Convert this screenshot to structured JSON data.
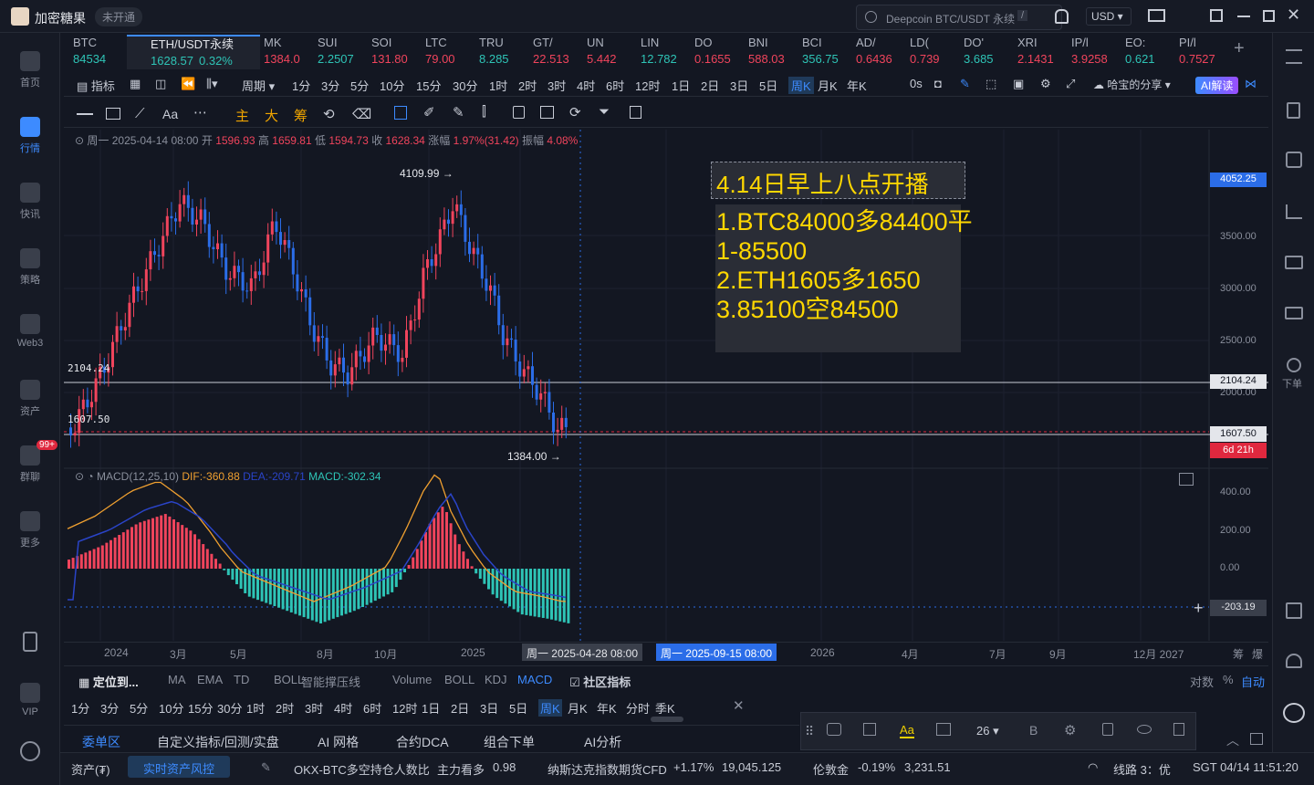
{
  "app": {
    "title": "加密糖果",
    "badge": "未开通",
    "search_placeholder": "Deepcoin BTC/USDT 永续",
    "search_shortcut": "/",
    "currency": "USD"
  },
  "nav": [
    {
      "label": "首页",
      "icon": "home-icon"
    },
    {
      "label": "行情",
      "icon": "chart-icon",
      "active": true
    },
    {
      "label": "快讯",
      "icon": "news-icon"
    },
    {
      "label": "策略",
      "icon": "robot-icon"
    },
    {
      "label": "Web3",
      "icon": "web3-icon"
    },
    {
      "label": "资产",
      "icon": "wallet-icon"
    },
    {
      "label": "群聊",
      "icon": "chat-icon",
      "badge": "99+"
    },
    {
      "label": "更多",
      "icon": "grid-icon"
    },
    {
      "label": "VIP",
      "icon": "vip-icon"
    }
  ],
  "tickers": [
    {
      "name": "BTC",
      "price": "84534"
    },
    {
      "name": "ETH/USDT永续",
      "price": "1628.57",
      "change": "0.32%",
      "active": true
    },
    {
      "name": "MK",
      "price": "1384.0"
    },
    {
      "name": "SUI",
      "price": "2.2507"
    },
    {
      "name": "SOI",
      "price": "131.80"
    },
    {
      "name": "LTC",
      "price": "79.00"
    },
    {
      "name": "TRU",
      "price": "8.285"
    },
    {
      "name": "GT/",
      "price": "22.513"
    },
    {
      "name": "UN",
      "price": "5.442"
    },
    {
      "name": "LIN",
      "price": "12.782"
    },
    {
      "name": "DO",
      "price": "0.1655"
    },
    {
      "name": "BNI",
      "price": "588.03"
    },
    {
      "name": "BCI",
      "price": "356.75"
    },
    {
      "name": "AD/",
      "price": "0.6436"
    },
    {
      "name": "LD(",
      "price": "0.739"
    },
    {
      "name": "DO'",
      "price": "3.685"
    },
    {
      "name": "XRI",
      "price": "2.1431"
    },
    {
      "name": "IP/l",
      "price": "3.9258"
    },
    {
      "name": "EO:",
      "price": "0.621"
    },
    {
      "name": "PI/l",
      "price": "0.7527"
    }
  ],
  "toolbar": {
    "indicator": "指标",
    "period": "周期",
    "periods": [
      "1分",
      "3分",
      "5分",
      "10分",
      "15分",
      "30分",
      "1时",
      "2时",
      "3时",
      "4时",
      "6时",
      "12时",
      "1日",
      "2日",
      "3日",
      "5日",
      "周K",
      "月K",
      "年K"
    ],
    "selected": "周K",
    "countdown": "0s",
    "share": "哈宝的分享",
    "ai": "AI解读"
  },
  "draw_tools": {
    "font": "Aa",
    "labels": [
      "主",
      "大",
      "筹"
    ]
  },
  "ohlc": {
    "date": "周一 2025-04-14 08:00",
    "open_label": "开",
    "open": "1596.93",
    "high_label": "高",
    "high": "1659.81",
    "low_label": "低",
    "low": "1594.73",
    "close_label": "收",
    "close": "1628.34",
    "change_label": "涨幅",
    "change": "1.97%(31.42)",
    "amp_label": "振幅",
    "amp": "4.08%"
  },
  "annotations": {
    "title": "4.14日早上八点开播",
    "lines": [
      "1.BTC84000多84400平",
      "1-85500",
      "2.ETH1605多1650",
      "3.85100空84500"
    ]
  },
  "price_marks": {
    "high": "4109.99",
    "low": "1384.00",
    "line1": "2104.24",
    "line2": "1607.50",
    "top_label": "4052.25",
    "countdown": "6d 21h"
  },
  "y_axis": [
    "3500.00",
    "3000.00",
    "2500.00",
    "2000.00"
  ],
  "macd": {
    "label": "MACD(12,25,10)",
    "dif": "DIF:-360.88",
    "dea": "DEA:-209.71",
    "macd": "MACD:-302.34",
    "axis": [
      "400.00",
      "200.00",
      "0.00"
    ],
    "cursor": "-203.19"
  },
  "x_axis": {
    "labels": [
      "2024",
      "3月",
      "5月",
      "8月",
      "10月",
      "2025",
      "2026",
      "4月",
      "7月",
      "9月",
      "12月 2027"
    ],
    "cursor1": "周一 2025-04-28 08:00",
    "cursor2": "周一 2025-09-15 08:00",
    "r1": "筹",
    "r2": "爆"
  },
  "indicators": {
    "locate": "定位到...",
    "list": [
      "MA",
      "EMA",
      "TD",
      "BOLL",
      "智能撑压线",
      "Volume",
      "BOLL",
      "KDJ",
      "MACD"
    ],
    "selected": "MACD",
    "community": "社区指标",
    "log": "对数",
    "pct": "%",
    "auto": "自动"
  },
  "periods2": [
    "1分",
    "3分",
    "5分",
    "10分",
    "15分",
    "30分",
    "1时",
    "2时",
    "3时",
    "4时",
    "6时",
    "12时",
    "1日",
    "2日",
    "3日",
    "5日",
    "周K",
    "月K",
    "年K",
    "分时",
    "季K"
  ],
  "bottom_tabs": [
    "委单区",
    "自定义指标/回测/实盘",
    "AI 网格",
    "合约DCA",
    "组合下单",
    "AI分析"
  ],
  "floating": {
    "size": "26",
    "bold": "B",
    "font": "Aa"
  },
  "status": {
    "asset": "资产(₮)",
    "risk": "实时资产风控",
    "okx": "OKX-BTC多空持仓人数比",
    "okx_tag": "主力看多",
    "okx_val": "0.98",
    "nas": "纳斯达克指数期货CFD",
    "nas_chg": "+1.17%",
    "nas_val": "19,045.125",
    "gold": "伦敦金",
    "gold_chg": "-0.19%",
    "gold_val": "3,231.51",
    "line": "线路 3：优",
    "time": "SGT 04/14 11:51:20"
  }
}
